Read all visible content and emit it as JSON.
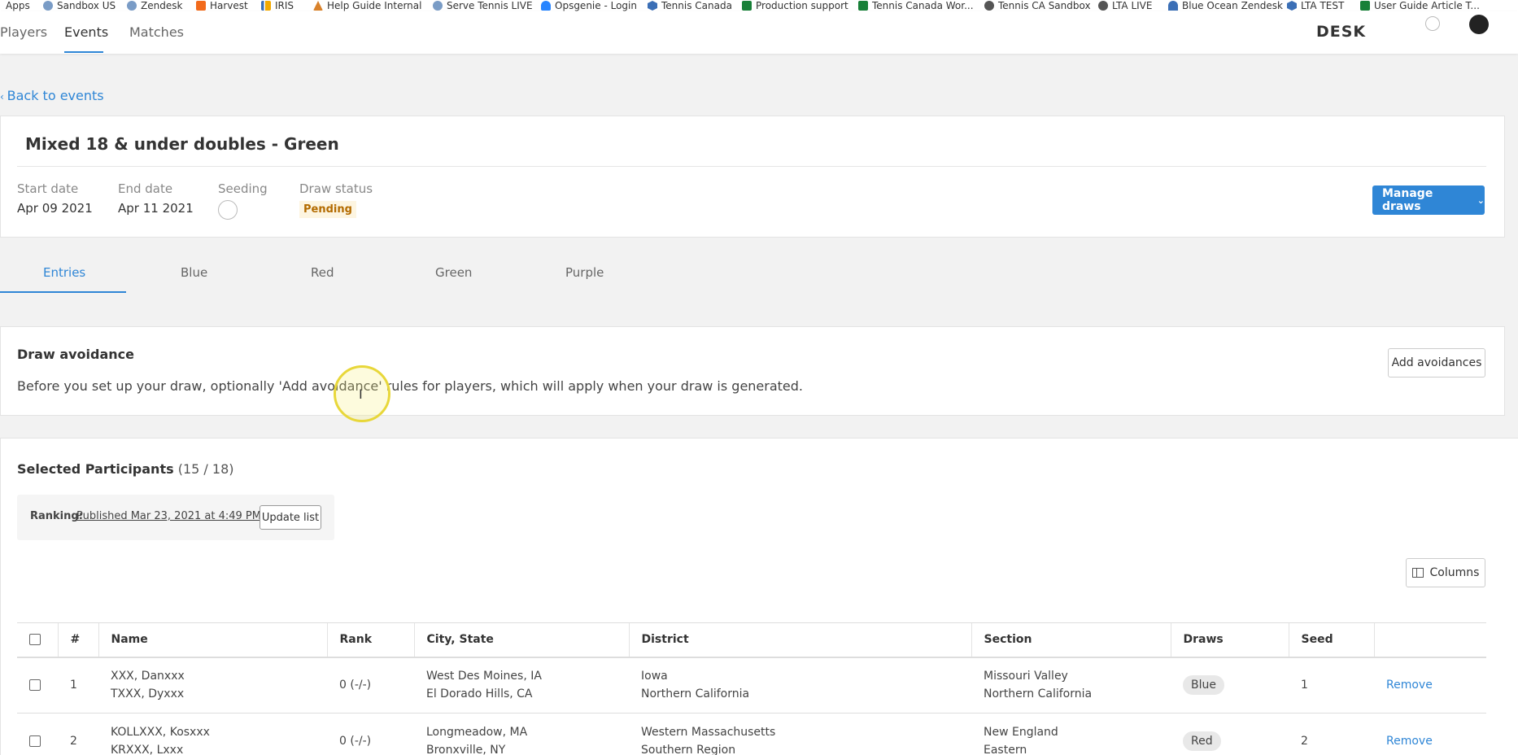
{
  "bookmarks": [
    {
      "label": "Apps",
      "color": "#4285f4"
    },
    {
      "label": "Sandbox US",
      "color": "#7a9cc6"
    },
    {
      "label": "Zendesk",
      "color": "#7a9cc6"
    },
    {
      "label": "Harvest",
      "color": "#f26a1b"
    },
    {
      "label": "IRIS",
      "color": "#3b6fb6"
    },
    {
      "label": "Help Guide Internal",
      "color": "#d9822b"
    },
    {
      "label": "Serve Tennis LIVE",
      "color": "#7a9cc6"
    },
    {
      "label": "Opsgenie - Login",
      "color": "#2684ff"
    },
    {
      "label": "Tennis Canada",
      "color": "#3b6fb6"
    },
    {
      "label": "Production support",
      "color": "#188038"
    },
    {
      "label": "Tennis Canada Wor...",
      "color": "#188038"
    },
    {
      "label": "Tennis CA Sandbox",
      "color": "#555555"
    },
    {
      "label": "LTA LIVE",
      "color": "#555555"
    },
    {
      "label": "Blue Ocean Zendesk",
      "color": "#3b6fb6"
    },
    {
      "label": "LTA TEST",
      "color": "#3b6fb6"
    },
    {
      "label": "User Guide Article T...",
      "color": "#188038"
    }
  ],
  "nav": {
    "tabs": [
      "Players",
      "Events",
      "Matches"
    ],
    "active": "Events",
    "brand": "DESK"
  },
  "back_link": "Back to events",
  "event": {
    "title": "Mixed 18 & under doubles - Green",
    "start_label": "Start date",
    "start_value": "Apr 09 2021",
    "end_label": "End date",
    "end_value": "Apr 11 2021",
    "seeding_label": "Seeding",
    "draw_status_label": "Draw status",
    "draw_status_value": "Pending",
    "manage_label": "Manage draws"
  },
  "subtabs": [
    "Entries",
    "Blue",
    "Red",
    "Green",
    "Purple"
  ],
  "avoidance": {
    "title": "Draw avoidance",
    "description": "Before you set up your draw, optionally 'Add avoidance' rules for players, which will apply when your draw is generated.",
    "button": "Add avoidances"
  },
  "participants": {
    "title": "Selected Participants",
    "count": "(15 / 18)",
    "ranking_label": "Ranking:",
    "ranking_link": "Published Mar 23, 2021 at 4:49 PM",
    "update_button": "Update list",
    "columns_button": "Columns",
    "headers": [
      "#",
      "Name",
      "Rank",
      "City, State",
      "District",
      "Section",
      "Draws",
      "Seed"
    ],
    "rows": [
      {
        "num": "1",
        "name1": "XXX, Danxxx",
        "name2": "TXXX, Dyxxx",
        "rank": "0 (-/-)",
        "city1": "West Des Moines, IA",
        "city2": "El Dorado Hills, CA",
        "district1": "Iowa",
        "district2": "Northern California",
        "section1": "Missouri Valley",
        "section2": "Northern California",
        "draw": "Blue",
        "seed": "1",
        "action": "Remove"
      },
      {
        "num": "2",
        "name1": "KOLLXXX, Kosxxx",
        "name2": "KRXXX, Lxxx",
        "rank": "0 (-/-)",
        "city1": "Longmeadow, MA",
        "city2": "Bronxville, NY",
        "district1": "Western Massachusetts",
        "district2": "Southern Region",
        "section1": "New England",
        "section2": "Eastern",
        "draw": "Red",
        "seed": "2",
        "action": "Remove"
      }
    ]
  }
}
